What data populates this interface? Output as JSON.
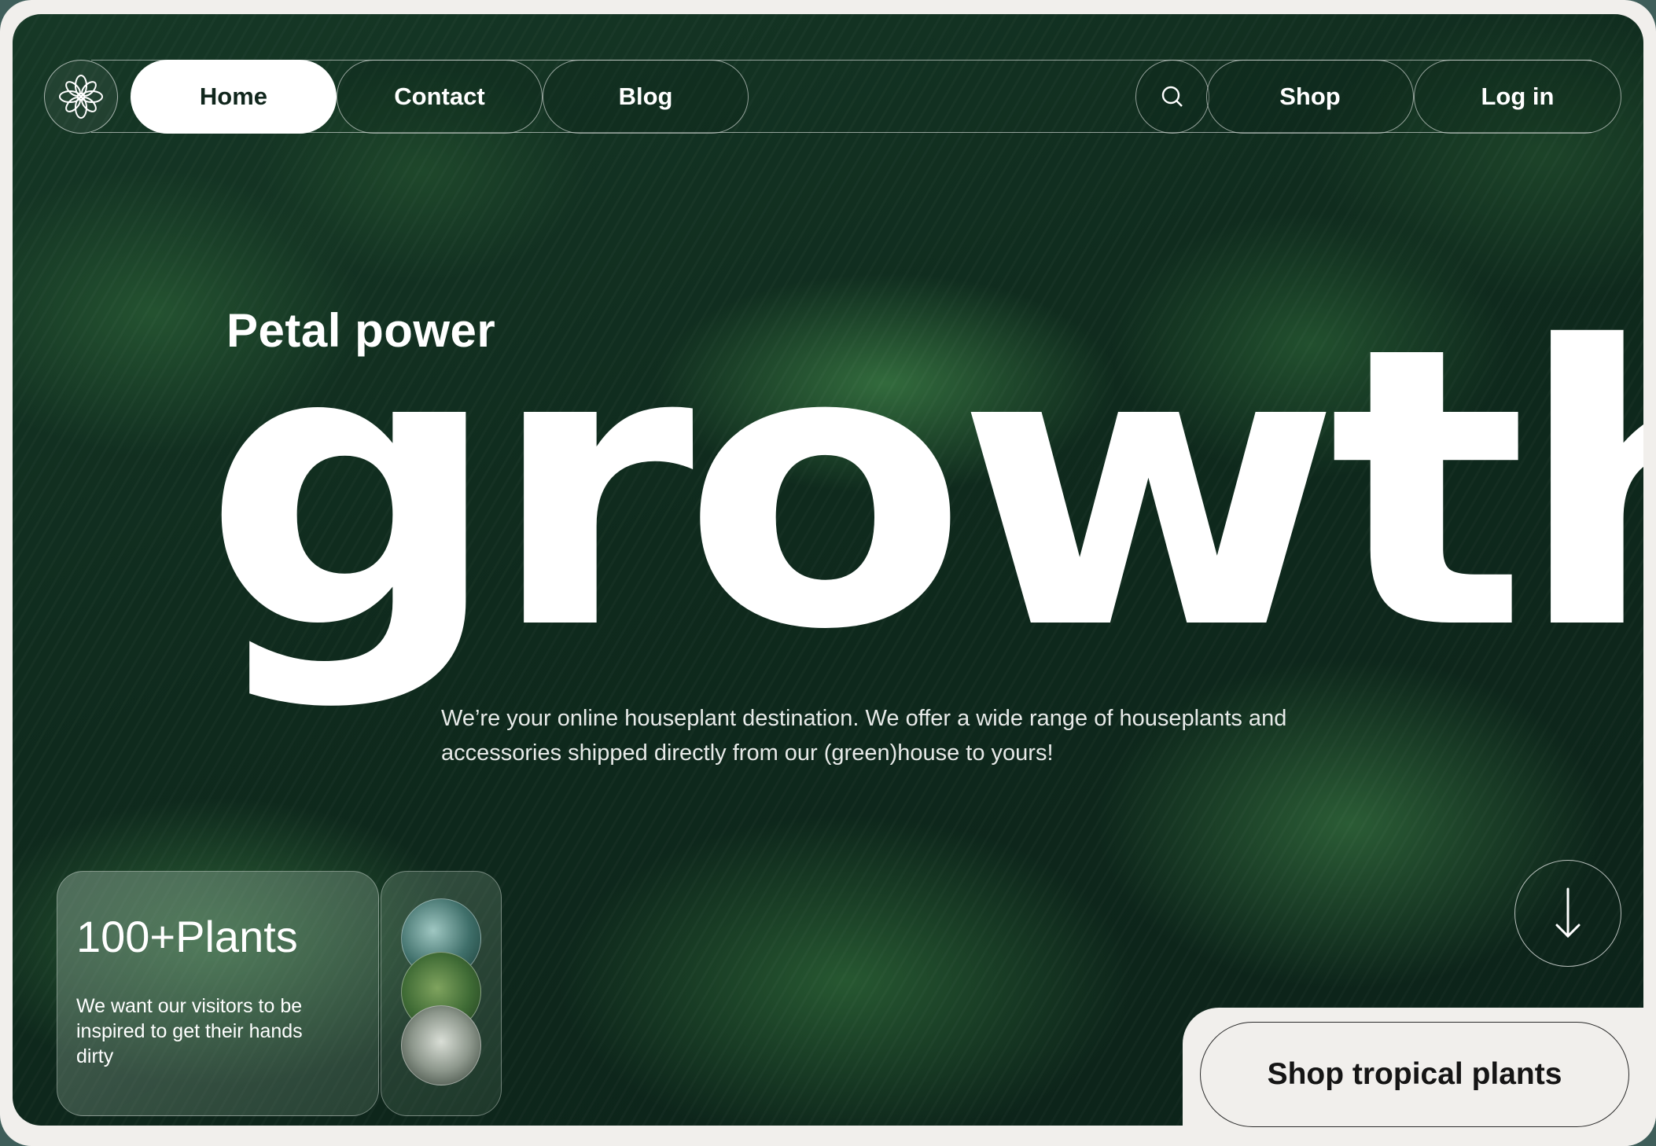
{
  "nav": {
    "items": [
      {
        "label": "Home",
        "active": true
      },
      {
        "label": "Contact",
        "active": false
      },
      {
        "label": "Blog",
        "active": false
      }
    ],
    "search_icon": "search-icon",
    "shop_label": "Shop",
    "login_label": "Log in",
    "logo_icon": "flower-logo-icon"
  },
  "hero": {
    "eyebrow": "Petal power",
    "headline": "growth",
    "tagline": "We’re your online houseplant destination. We offer a wide range of houseplants and accessories shipped directly from our (green)house to yours!"
  },
  "stats": {
    "title": "100+Plants",
    "text": "We want our visitors to be inspired to get their hands dirty"
  },
  "scroll": {
    "icon": "arrow-down-icon"
  },
  "cta": {
    "label": "Shop tropical plants"
  },
  "colors": {
    "background_green": "#0f2a1d",
    "text_white": "#ffffff",
    "page_cream": "#f1efec"
  }
}
